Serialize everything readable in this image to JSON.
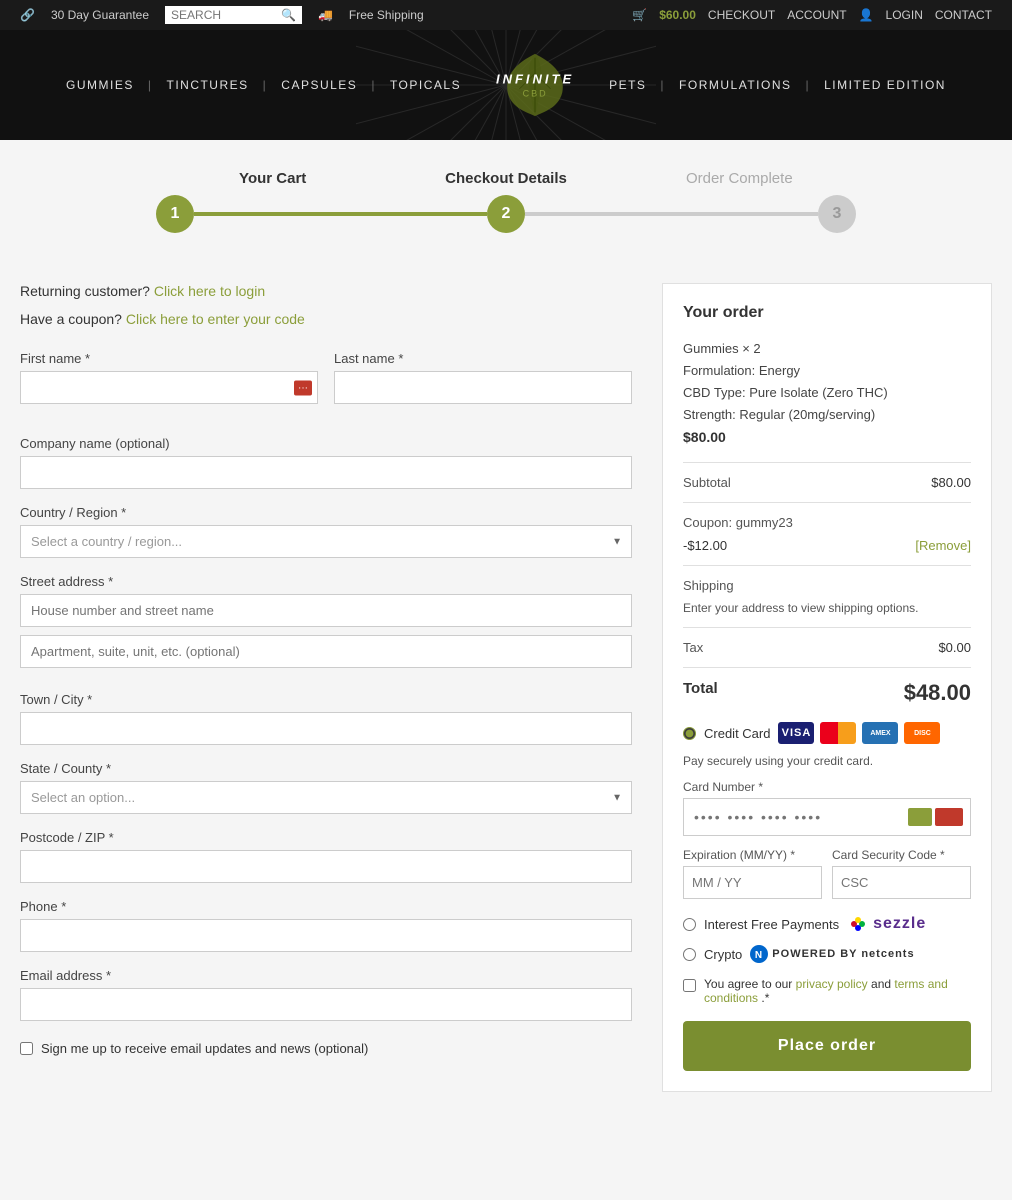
{
  "topbar": {
    "guarantee": "30 Day Guarantee",
    "search_placeholder": "SEARCH",
    "free_shipping": "Free Shipping",
    "cart_amount": "$60.00",
    "checkout": "CHECKOUT",
    "account": "ACCOUNT",
    "login": "LOGIN",
    "contact": "CONTACT"
  },
  "nav": {
    "items": [
      "GUMMIES",
      "TINCTURES",
      "CAPSULES",
      "TOPICALS",
      "PETS",
      "FORMULATIONS",
      "LIMITED EDITION"
    ],
    "logo": "iNFiNiTe"
  },
  "progress": {
    "step1_label": "Your Cart",
    "step2_label": "Checkout Details",
    "step3_label": "Order Complete",
    "step1": "1",
    "step2": "2",
    "step3": "3"
  },
  "form": {
    "returning_prefix": "Returning customer?",
    "returning_link": "Click here to login",
    "coupon_prefix": "Have a coupon?",
    "coupon_link": "Click here to enter your code",
    "first_name_label": "First name *",
    "last_name_label": "Last name *",
    "company_label": "Company name (optional)",
    "country_label": "Country / Region *",
    "country_placeholder": "Select a country / region...",
    "street_label": "Street address *",
    "street_placeholder": "House number and street name",
    "apt_placeholder": "Apartment, suite, unit, etc. (optional)",
    "city_label": "Town / City *",
    "state_label": "State / County *",
    "state_placeholder": "Select an option...",
    "postcode_label": "Postcode / ZIP *",
    "phone_label": "Phone *",
    "email_label": "Email address *",
    "signup_label": "Sign me up to receive email updates and news (optional)"
  },
  "order": {
    "title": "Your order",
    "product": "Gummies × 2",
    "formulation": "Formulation: Energy",
    "cbd_type": "CBD Type: Pure Isolate (Zero THC)",
    "strength": "Strength: Regular (20mg/serving)",
    "item_price": "$80.00",
    "subtotal_label": "Subtotal",
    "subtotal": "$80.00",
    "coupon_label": "Coupon: gummy23",
    "coupon_discount": "-$12.00",
    "remove_label": "[Remove]",
    "shipping_label": "Shipping",
    "shipping_note": "Enter your address to view shipping options.",
    "tax_label": "Tax",
    "tax": "$0.00",
    "total_label": "Total",
    "total": "$48.00"
  },
  "payment": {
    "credit_card_label": "Credit Card",
    "pay_note": "Pay securely using your credit card.",
    "card_number_label": "Card Number *",
    "card_placeholder": "•••• •••• •••• ••••",
    "expiry_label": "Expiration (MM/YY) *",
    "expiry_placeholder": "MM / YY",
    "csc_label": "Card Security Code *",
    "csc_placeholder": "CSC",
    "sezzle_label": "Interest Free Payments",
    "sezzle_brand": "sezzle",
    "crypto_label": "Crypto",
    "crypto_brand": "POWERED BY  netcents",
    "terms_prefix": "You agree to our",
    "privacy_link": "privacy policy",
    "and": "and",
    "terms_link": "terms and conditions",
    "terms_suffix": ".*",
    "place_order": "Place order"
  }
}
